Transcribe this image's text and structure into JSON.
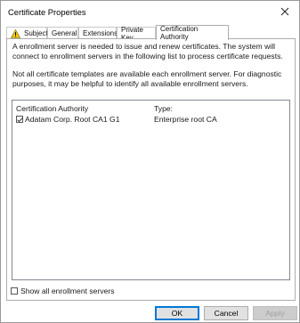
{
  "window": {
    "title": "Certificate Properties",
    "close_icon": "close-icon"
  },
  "tabs": [
    {
      "label": "Subject",
      "icon": "warning-icon"
    },
    {
      "label": "General"
    },
    {
      "label": "Extensions"
    },
    {
      "label": "Private Key"
    },
    {
      "label": "Certification Authority",
      "active": true
    }
  ],
  "panel": {
    "intro": "A enrollment server is needed to issue and renew certificates. The system will connect to enrollment servers in the following list to process certificate requests.",
    "note": "Not all certificate templates are available each enrollment server. For diagnostic purposes, it may be helpful to identify all available enrollment servers.",
    "list": {
      "columns": [
        "Certification Authority",
        "Type:"
      ],
      "rows": [
        {
          "checked": true,
          "authority": "Adatam Corp. Root CA1 G1",
          "type": "Enterprise root CA"
        }
      ]
    },
    "show_all_label": "Show all enrollment servers",
    "show_all_checked": false
  },
  "buttons": {
    "ok": "OK",
    "cancel": "Cancel",
    "apply": "Apply"
  },
  "colors": {
    "accent": "#0078d7",
    "warning": "#f2c811"
  }
}
